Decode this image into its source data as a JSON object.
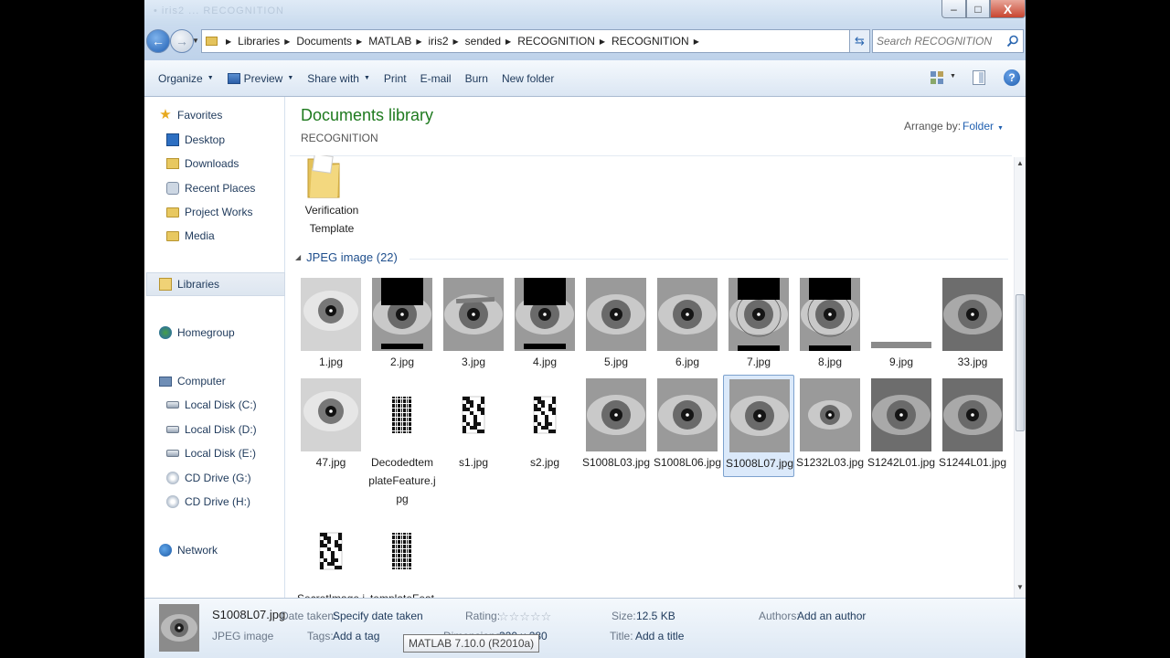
{
  "window": {
    "title_ghost": "•  iris2  ...  RECOGNITION",
    "min_label": "–",
    "max_label": "□",
    "close_label": "X"
  },
  "address": {
    "crumbs": [
      "Libraries",
      "Documents",
      "MATLAB",
      "iris2",
      "sended",
      "RECOGNITION",
      "RECOGNITION"
    ],
    "search_placeholder": "Search RECOGNITION"
  },
  "toolbar": {
    "organize": "Organize",
    "preview": "Preview",
    "share_with": "Share with",
    "print": "Print",
    "email": "E-mail",
    "burn": "Burn",
    "new_folder": "New folder",
    "help": "?"
  },
  "sidebar": {
    "favorites": "Favorites",
    "desktop": "Desktop",
    "downloads": "Downloads",
    "recent_places": "Recent Places",
    "project_works": "Project Works",
    "media": "Media",
    "libraries": "Libraries",
    "homegroup": "Homegroup",
    "computer": "Computer",
    "drive_c": "Local Disk (C:)",
    "drive_d": "Local Disk (D:)",
    "drive_e": "Local Disk (E:)",
    "drive_g": "CD Drive (G:)",
    "drive_h": "CD Drive (H:)",
    "network": "Network"
  },
  "content": {
    "library_title": "Documents library",
    "library_subtitle": "RECOGNITION",
    "arrange_label": "Arrange by:",
    "arrange_value": "Folder",
    "folder_name_1": "Verification",
    "folder_name_2": "Template",
    "group_header": "JPEG image (22)",
    "files": [
      {
        "name": "1.jpg",
        "kind": "eye-light"
      },
      {
        "name": "2.jpg",
        "kind": "eye-masked"
      },
      {
        "name": "3.jpg",
        "kind": "eye-band"
      },
      {
        "name": "4.jpg",
        "kind": "eye-masked"
      },
      {
        "name": "5.jpg",
        "kind": "eye"
      },
      {
        "name": "6.jpg",
        "kind": "eye"
      },
      {
        "name": "7.jpg",
        "kind": "eye-masked-ring"
      },
      {
        "name": "8.jpg",
        "kind": "eye-masked-ring"
      },
      {
        "name": "9.jpg",
        "kind": "strip"
      },
      {
        "name": "33.jpg",
        "kind": "eye-dark"
      },
      {
        "name": "47.jpg",
        "kind": "eye-light"
      },
      {
        "name": "Decodedtem plateFeature.j pg",
        "kind": "barcode"
      },
      {
        "name": "s1.jpg",
        "kind": "noise"
      },
      {
        "name": "s2.jpg",
        "kind": "noise"
      },
      {
        "name": "S1008L03.jpg",
        "kind": "eye"
      },
      {
        "name": "S1008L06.jpg",
        "kind": "eye"
      },
      {
        "name": "S1008L07.jpg",
        "kind": "eye",
        "selected": true
      },
      {
        "name": "S1232L03.jpg",
        "kind": "eye-small"
      },
      {
        "name": "S1242L01.jpg",
        "kind": "eye-dark"
      },
      {
        "name": "S1244L01.jpg",
        "kind": "eye-dark"
      },
      {
        "name": "SecretImage.j pg",
        "kind": "noise"
      },
      {
        "name": "templateFeat ure.jpg",
        "kind": "barcode"
      }
    ]
  },
  "details": {
    "file_name": "S1008L07.jpg",
    "file_type": "JPEG image",
    "date_taken_label": "Date taken:",
    "date_taken_value": "Specify date taken",
    "tags_label": "Tags:",
    "tags_value": "Add a tag",
    "rating_label": "Rating:",
    "rating": 0,
    "stars": "☆☆☆☆☆",
    "dimensions_label": "Dimensions:",
    "dimensions_value": "320 x 280",
    "size_label": "Size:",
    "size_value": "12.5 KB",
    "title_label": "Title:",
    "title_value": "Add a title",
    "authors_label": "Authors:",
    "authors_value": "Add an author"
  },
  "tooltip": {
    "text": "MATLAB  7.10.0 (R2010a)"
  }
}
